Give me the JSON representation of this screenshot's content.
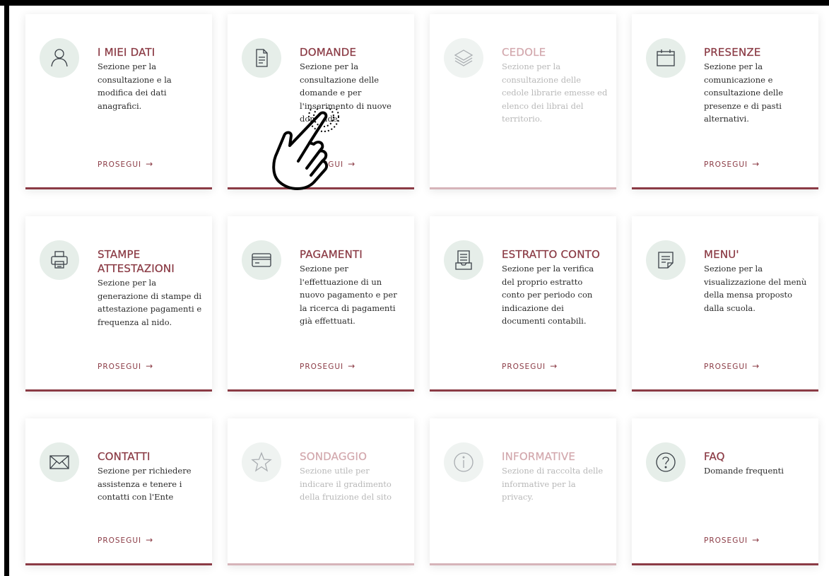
{
  "colors": {
    "accent": "#8b3b45",
    "accent_disabled": "#d6b4b9",
    "icon_bg": "#e6eee9"
  },
  "cards": [
    {
      "title": "I MIEI DATI",
      "description": "Sezione per la consultazione e la modifica dei dati anagrafici.",
      "cta": "PROSEGUI",
      "icon": "user-icon",
      "enabled": true
    },
    {
      "title": "DOMANDE",
      "description": "Sezione per la consultazione delle domande e per l'inserimento di nuove domande.",
      "cta": "PROSEGUI",
      "icon": "document-icon",
      "enabled": true
    },
    {
      "title": "CEDOLE",
      "description": "Sezione per la consultazione delle cedole librarie emesse ed elenco dei librai del territorio.",
      "cta": "",
      "icon": "layers-icon",
      "enabled": false
    },
    {
      "title": "PRESENZE",
      "description": "Sezione per la comunicazione e consultazione delle presenze e di pasti alternativi.",
      "cta": "PROSEGUI",
      "icon": "calendar-icon",
      "enabled": true
    },
    {
      "title": "STAMPE ATTESTAZIONI",
      "description": "Sezione per la generazione di stampe di attestazione pagamenti e frequenza al nido.",
      "cta": "PROSEGUI",
      "icon": "printer-icon",
      "enabled": true
    },
    {
      "title": "PAGAMENTI",
      "description": "Sezione per l'effettuazione di un nuovo pagamento e per la ricerca di pagamenti già effettuati.",
      "cta": "PROSEGUI",
      "icon": "credit-card-icon",
      "enabled": true
    },
    {
      "title": "ESTRATTO CONTO",
      "description": "Sezione per la verifica del proprio estratto conto per periodo con indicazione dei documenti contabili.",
      "cta": "PROSEGUI",
      "icon": "statement-icon",
      "enabled": true
    },
    {
      "title": "MENU'",
      "description": "Sezione per la visualizzazione del menù della mensa proposto dalla scuola.",
      "cta": "PROSEGUI",
      "icon": "menu-note-icon",
      "enabled": true
    },
    {
      "title": "CONTATTI",
      "description": "Sezione per richiedere assistenza e tenere i contatti con l'Ente",
      "cta": "PROSEGUI",
      "icon": "envelope-icon",
      "enabled": true
    },
    {
      "title": "SONDAGGIO",
      "description": "Sezione utile per indicare il gradimento della fruizione del sito",
      "cta": "",
      "icon": "star-icon",
      "enabled": false
    },
    {
      "title": "INFORMATIVE",
      "description": "Sezione di raccolta delle informative per la privacy.",
      "cta": "",
      "icon": "info-icon",
      "enabled": false
    },
    {
      "title": "FAQ",
      "description": "Domande frequenti",
      "cta": "PROSEGUI",
      "icon": "question-icon",
      "enabled": true
    }
  ],
  "arrow_glyph": "→"
}
